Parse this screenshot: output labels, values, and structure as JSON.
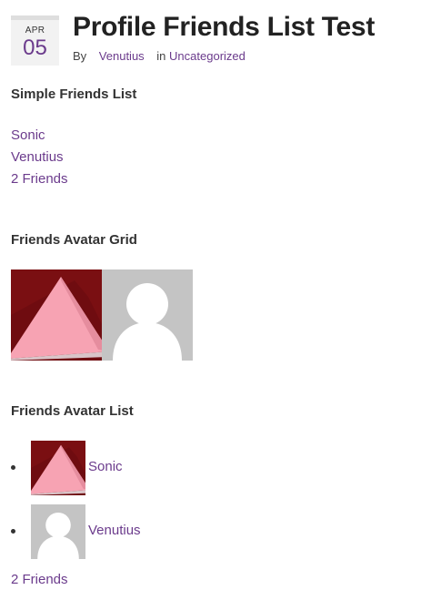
{
  "post": {
    "date_month": "APR",
    "date_day": "05",
    "title": "Profile Friends List Test",
    "meta_by": "By",
    "meta_author": "Venutius",
    "meta_in": "in",
    "meta_category": "Uncategorized"
  },
  "simple_list": {
    "heading": "Simple Friends List",
    "friends": [
      "Sonic",
      "Venutius"
    ],
    "count": "2 Friends"
  },
  "avatar_grid": {
    "heading": "Friends Avatar Grid",
    "avatars": [
      {
        "icon": "pyramid-avatar"
      },
      {
        "icon": "default-person-avatar"
      }
    ]
  },
  "avatar_list": {
    "heading": "Friends Avatar List",
    "items": [
      {
        "name": "Sonic",
        "icon": "pyramid-avatar"
      },
      {
        "name": "Venutius",
        "icon": "default-person-avatar"
      }
    ],
    "count": "2 Friends"
  },
  "colors": {
    "link": "#6b3b8c",
    "text": "#333333",
    "avatar_bg_dark_red": "#7a0f12",
    "avatar_pyramid_pink": "#f7a3b3",
    "default_avatar_bg": "#c4c4c4"
  }
}
